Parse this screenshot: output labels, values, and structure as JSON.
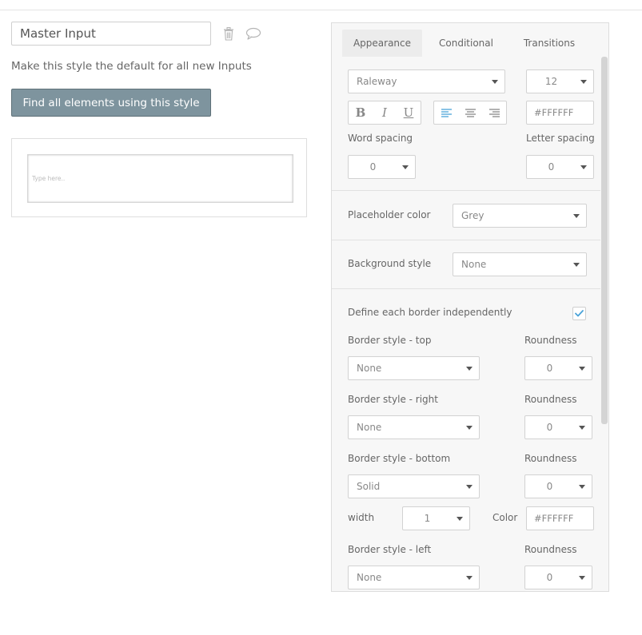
{
  "header": {
    "style_name": "Master Input",
    "default_text": "Make this style the default for all new Inputs",
    "find_button": "Find all elements using this style",
    "preview_placeholder": "Type here.."
  },
  "icons": {
    "delete": "trash-icon",
    "comment": "comment-icon",
    "align_left": "align-left-icon",
    "align_center": "align-center-icon",
    "align_right": "align-right-icon",
    "check": "check-icon"
  },
  "colors": {
    "accent": "#4aa3d8",
    "find_button_bg": "#7e949e"
  },
  "tabs": [
    {
      "label": "Appearance",
      "active": true
    },
    {
      "label": "Conditional",
      "active": false
    },
    {
      "label": "Transitions",
      "active": false
    }
  ],
  "font": {
    "family": "Raleway",
    "size": "12",
    "bold": "B",
    "italic": "I",
    "underline": "U",
    "color": "#FFFFFF",
    "word_spacing_label": "Word spacing",
    "word_spacing": "0",
    "letter_spacing_label": "Letter spacing",
    "letter_spacing": "0"
  },
  "placeholder": {
    "label": "Placeholder color",
    "value": "Grey"
  },
  "background": {
    "label": "Background style",
    "value": "None"
  },
  "borders": {
    "independent_label": "Define each border independently",
    "independent_checked": true,
    "roundness_label": "Roundness",
    "width_label": "width",
    "color_label": "Color",
    "top": {
      "label": "Border style - top",
      "style": "None",
      "roundness": "0"
    },
    "right": {
      "label": "Border style - right",
      "style": "None",
      "roundness": "0"
    },
    "bottom": {
      "label": "Border style - bottom",
      "style": "Solid",
      "roundness": "0",
      "width": "1",
      "color": "#FFFFFF"
    },
    "left": {
      "label": "Border style - left",
      "style": "None",
      "roundness": "0"
    }
  }
}
